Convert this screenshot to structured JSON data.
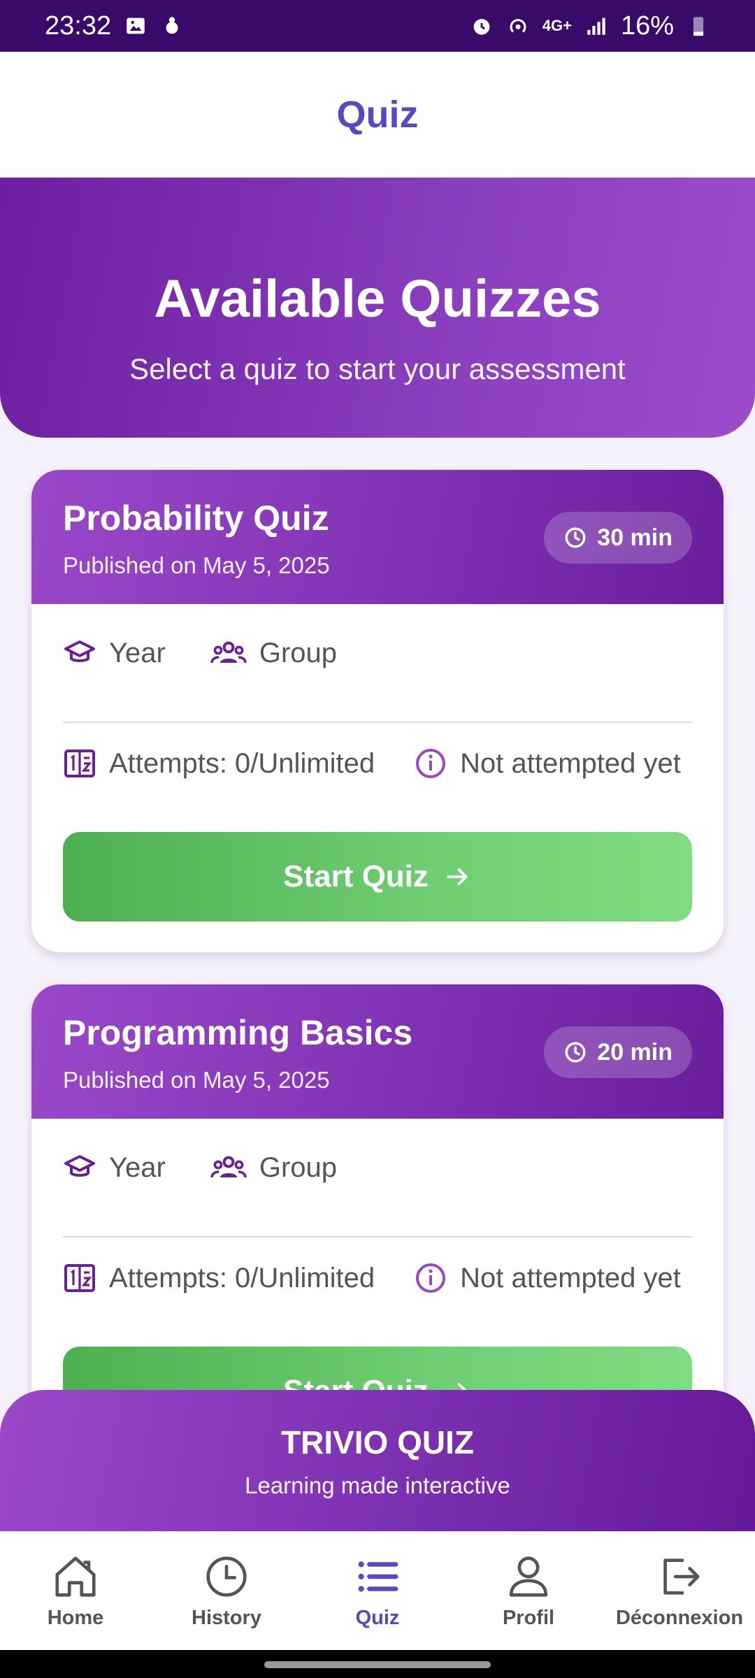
{
  "status_bar": {
    "time": "23:32",
    "network": "4G+",
    "battery": "16%"
  },
  "header": {
    "title": "Quiz"
  },
  "hero": {
    "title": "Available Quizzes",
    "subtitle": "Select a quiz to start your assessment"
  },
  "quizzes": [
    {
      "title": "Probability Quiz",
      "published": "Published on May 5, 2025",
      "duration": "30 min",
      "year_label": "Year",
      "group_label": "Group",
      "attempts": "Attempts: 0/Unlimited",
      "status": "Not attempted yet",
      "button_label": "Start Quiz"
    },
    {
      "title": "Programming Basics",
      "published": "Published on May 5, 2025",
      "duration": "20 min",
      "year_label": "Year",
      "group_label": "Group",
      "attempts": "Attempts: 0/Unlimited",
      "status": "Not attempted yet",
      "button_label": "Start Quiz"
    }
  ],
  "brand": {
    "title": "TRIVIO QUIZ",
    "subtitle": "Learning made interactive"
  },
  "nav": {
    "items": [
      {
        "label": "Home",
        "icon": "home-icon",
        "active": false
      },
      {
        "label": "History",
        "icon": "clock-icon",
        "active": false
      },
      {
        "label": "Quiz",
        "icon": "list-icon",
        "active": true
      },
      {
        "label": "Profil",
        "icon": "person-icon",
        "active": false
      },
      {
        "label": "Déconnexion",
        "icon": "logout-icon",
        "active": false
      }
    ]
  },
  "colors": {
    "accent": "#5b46c4",
    "header_purple": "#7f33b4",
    "button_green": "#4caf50",
    "icon_purple": "#6a1d9c"
  }
}
